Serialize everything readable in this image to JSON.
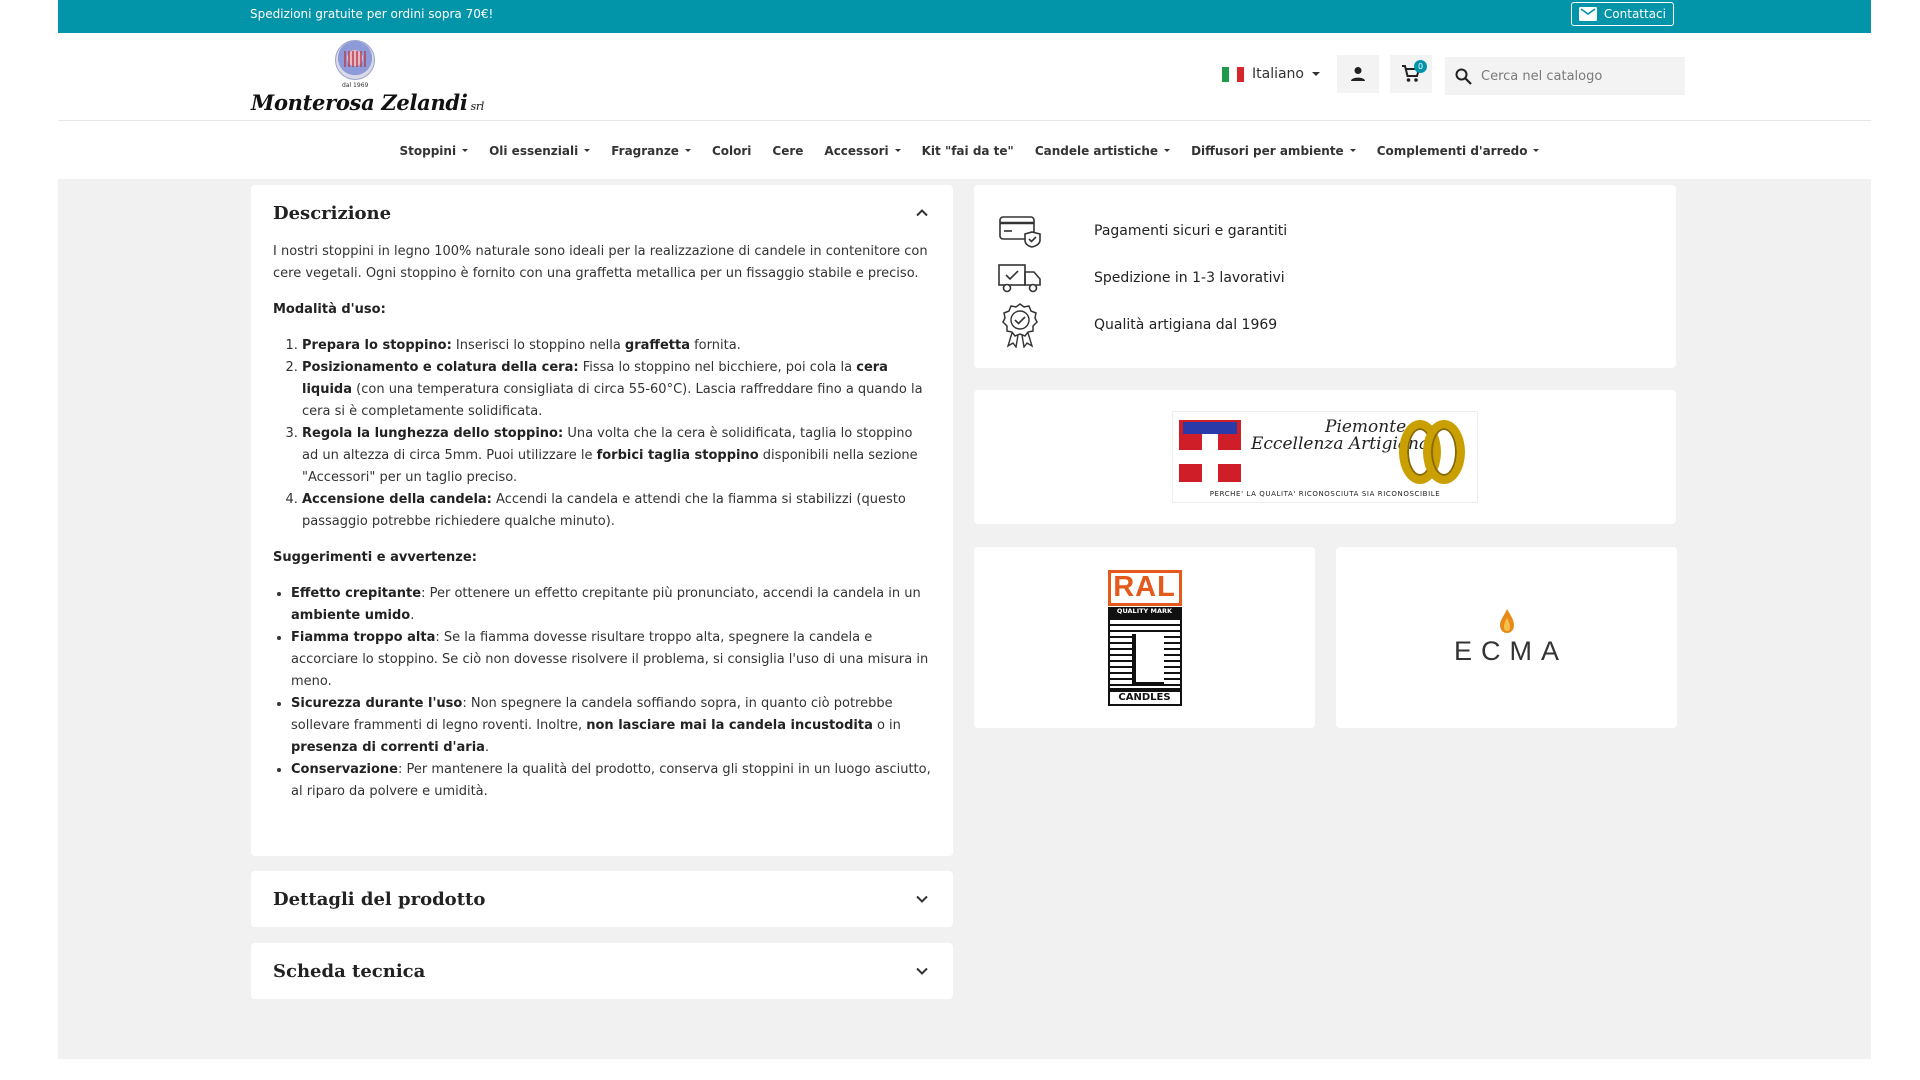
{
  "topbar": {
    "promo": "Spedizioni gratuite per ordini sopra 70€!",
    "contact_label": "Contattaci"
  },
  "brand": {
    "name": "Monterosa Zelandi",
    "suffix": "srl",
    "since": "dal 1969"
  },
  "header": {
    "language": "Italiano",
    "cart_count": "0",
    "search_placeholder": "Cerca nel catalogo"
  },
  "nav": [
    {
      "label": "Stoppini",
      "dropdown": true
    },
    {
      "label": "Oli essenziali",
      "dropdown": true
    },
    {
      "label": "Fragranze",
      "dropdown": true
    },
    {
      "label": "Colori",
      "dropdown": false
    },
    {
      "label": "Cere",
      "dropdown": false
    },
    {
      "label": "Accessori",
      "dropdown": true
    },
    {
      "label": "Kit \"fai da te\"",
      "dropdown": false
    },
    {
      "label": "Candele artistiche",
      "dropdown": true
    },
    {
      "label": "Diffusori per ambiente",
      "dropdown": true
    },
    {
      "label": "Complementi d'arredo",
      "dropdown": true
    }
  ],
  "description": {
    "title": "Descrizione",
    "intro": "I nostri stoppini in legno 100% naturale sono ideali per la realizzazione di candele in contenitore con cere vegetali. Ogni stoppino è fornito con una graffetta metallica per un fissaggio stabile e preciso.",
    "usage_heading": "Modalità d'uso:",
    "steps": [
      [
        {
          "b": "Prepara lo stoppino:"
        },
        {
          "t": " Inserisci lo stoppino nella "
        },
        {
          "b": "graffetta"
        },
        {
          "t": " fornita."
        }
      ],
      [
        {
          "b": "Posizionamento e colatura della cera:"
        },
        {
          "t": " Fissa lo stoppino nel bicchiere, poi cola la "
        },
        {
          "b": "cera liquida"
        },
        {
          "t": " (con una temperatura consigliata di circa 55-60°C). Lascia raffreddare fino a quando la cera si è completamente solidificata."
        }
      ],
      [
        {
          "b": "Regola la lunghezza dello stoppino:"
        },
        {
          "t": " Una volta che la cera è solidificata, taglia lo stoppino ad un altezza di circa 5mm. Puoi utilizzare le "
        },
        {
          "b": "forbici taglia stoppino"
        },
        {
          "t": " disponibili nella sezione \"Accessori\" per un taglio preciso."
        }
      ],
      [
        {
          "b": "Accensione della candela:"
        },
        {
          "t": " Accendi la candela e attendi che la fiamma si stabilizzi (questo passaggio potrebbe richiedere qualche minuto)."
        }
      ]
    ],
    "tips_heading": "Suggerimenti e avvertenze:",
    "tips": [
      [
        {
          "b": "Effetto crepitante"
        },
        {
          "t": ": Per ottenere un effetto crepitante più pronunciato, accendi la candela in un "
        },
        {
          "b": "ambiente umido"
        },
        {
          "t": "."
        }
      ],
      [
        {
          "b": "Fiamma troppo alta"
        },
        {
          "t": ": Se la fiamma dovesse risultare troppo alta, spegnere la candela e accorciare lo stoppino. Se ciò non dovesse risolvere il problema, si consiglia l'uso di una misura in meno."
        }
      ],
      [
        {
          "b": "Sicurezza durante l'uso"
        },
        {
          "t": ": Non spegnere la candela soffiando sopra, in quanto ciò potrebbe sollevare frammenti di legno roventi. Inoltre, "
        },
        {
          "b": "non lasciare mai la candela incustodita"
        },
        {
          "t": " o in "
        },
        {
          "b": "presenza di correnti d'aria"
        },
        {
          "t": "."
        }
      ],
      [
        {
          "b": "Conservazione"
        },
        {
          "t": ": Per mantenere la qualità del prodotto, conserva gli stoppini in un luogo asciutto, al riparo da polvere e umidità."
        }
      ]
    ]
  },
  "accordions": {
    "details": "Dettagli del prodotto",
    "datasheet": "Scheda tecnica"
  },
  "features": [
    {
      "icon": "credit-card-shield-icon",
      "label": "Pagamenti sicuri e garantiti"
    },
    {
      "icon": "delivery-truck-icon",
      "label": "Spedizione in 1-3 lavorativi"
    },
    {
      "icon": "quality-badge-icon",
      "label": "Qualità artigiana dal 1969"
    }
  ],
  "badges": {
    "piemonte_line1": "Piemonte",
    "piemonte_line2": "Eccellenza Artigiana",
    "piemonte_tagline": "PERCHE' LA QUALITA' RICONOSCIUTA SIA RICONOSCIBILE",
    "ral_top": "RAL",
    "ral_mark": "QUALITY MARK",
    "ral_bottom": "CANDLES",
    "ecma": "ECMA"
  },
  "colors": {
    "accent": "#0295a9",
    "page_bg": "#f1f1f1"
  }
}
